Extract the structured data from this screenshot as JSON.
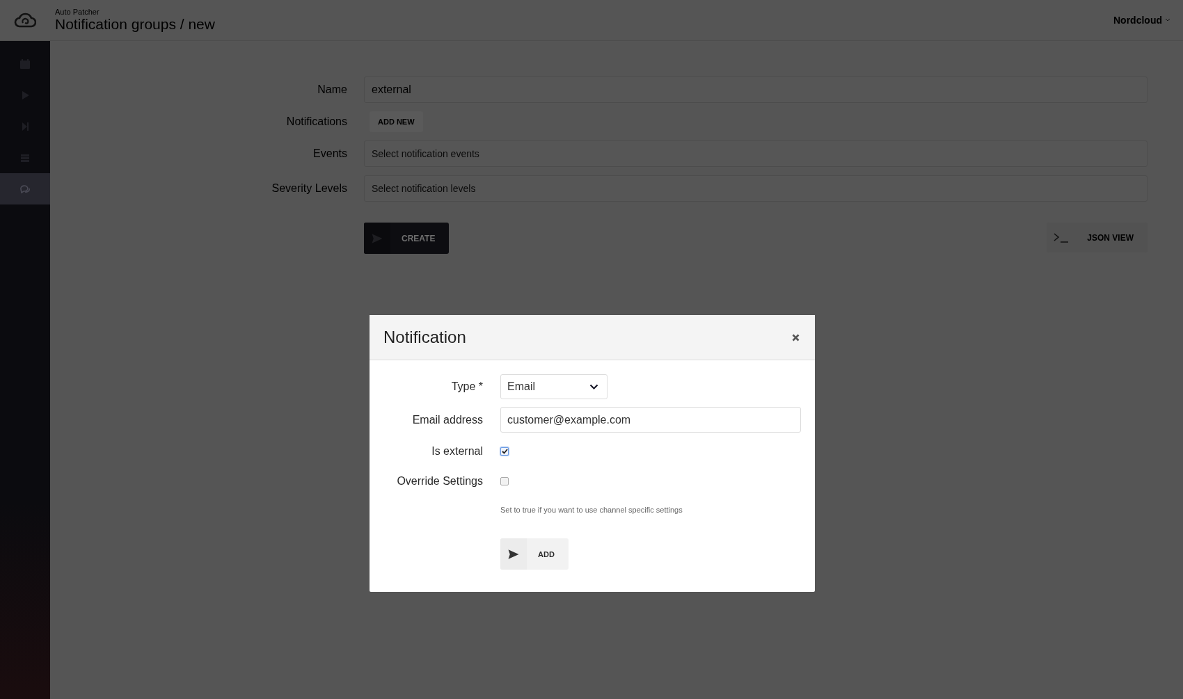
{
  "header": {
    "app": "Auto Patcher",
    "title": "Notification groups / new",
    "account": "Nordcloud"
  },
  "sidebar": {
    "items": [
      {
        "kind": "calendar",
        "selected": false
      },
      {
        "kind": "play",
        "selected": false
      },
      {
        "kind": "skip",
        "selected": false
      },
      {
        "kind": "list",
        "selected": false
      },
      {
        "kind": "chat",
        "selected": true
      }
    ]
  },
  "form": {
    "fields": [
      {
        "kind": "input",
        "label": "Name",
        "value": "external"
      },
      {
        "kind": "button",
        "label": "Notifications",
        "button": "ADD NEW"
      },
      {
        "kind": "select",
        "label": "Events",
        "placeholder": "Select notification events"
      },
      {
        "kind": "select",
        "label": "Severity Levels",
        "placeholder": "Select notification levels"
      }
    ],
    "create": "CREATE",
    "json_view": "JSON VIEW"
  },
  "modal": {
    "title": "Notification",
    "fields": [
      {
        "kind": "select",
        "label": "Type *",
        "value": "Email"
      },
      {
        "kind": "input",
        "label": "Email address",
        "value": "customer@example.com"
      },
      {
        "kind": "checkbox",
        "label": "Is external",
        "checked": true
      },
      {
        "kind": "checkbox",
        "label": "Override Settings",
        "checked": false,
        "help": "Set to true if you want to use channel specific settings"
      }
    ],
    "submit": "ADD"
  }
}
